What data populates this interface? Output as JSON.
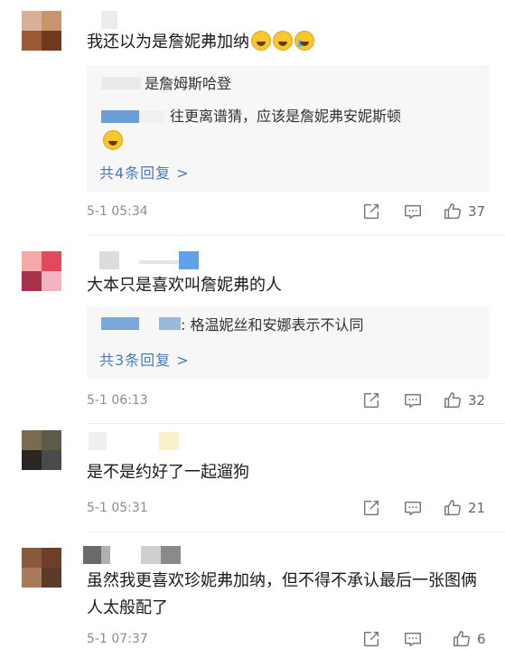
{
  "comments": [
    {
      "text": "我还以为是詹妮弗加纳",
      "avatar_colors": [
        "#d8b09a",
        "#c9956c",
        "#9a5a33",
        "#6e3b1e"
      ],
      "emojis": [
        "laugh-cry-emoji",
        "laugh-cry-emoji",
        "crying-emoji"
      ],
      "replies": [
        {
          "text": "是詹姆斯哈登"
        },
        {
          "text": "往更离谱猜，应该是詹妮弗安妮斯顿"
        }
      ],
      "more_replies": "共4条回复 >",
      "time": "5-1 05:34",
      "likes": "37"
    },
    {
      "text": "大本只是喜欢叫詹妮弗的人",
      "avatar_colors": [
        "#f4a9a8",
        "#e04a5c",
        "#a8324a",
        "#f2b5c0"
      ],
      "replies": [
        {
          "text": ": 格温妮丝和安娜表示不认同"
        }
      ],
      "more_replies": "共3条回复 >",
      "time": "5-1 06:13",
      "likes": "32"
    },
    {
      "text": "是不是约好了一起遛狗",
      "avatar_colors": [
        "#7a6a50",
        "#5c5a48",
        "#2a2622",
        "#4a4a4a"
      ],
      "time": "5-1 05:31",
      "likes": "21"
    },
    {
      "text": "虽然我更喜欢珍妮弗加纳，但不得不承认最后一张图俩人太般配了",
      "avatar_colors": [
        "#8a5a3c",
        "#6e4028",
        "#a87a5a",
        "#5a3a28"
      ],
      "time": "5-1 07:37",
      "likes": "6"
    }
  ]
}
